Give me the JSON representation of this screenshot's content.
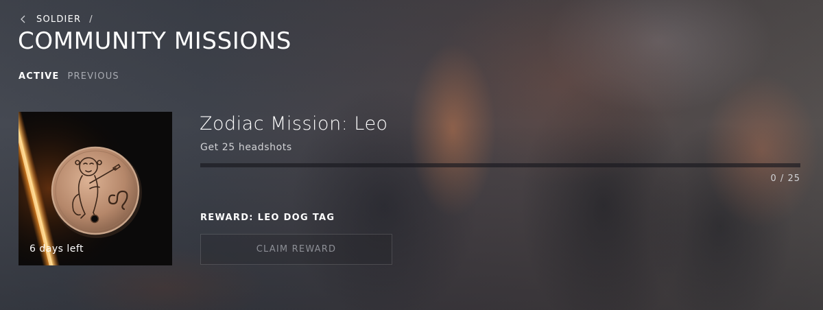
{
  "breadcrumb": {
    "back_icon": "chevron-left-icon",
    "parent": "SOLDIER",
    "separator": "/"
  },
  "page_title": "COMMUNITY MISSIONS",
  "tabs": [
    {
      "label": "ACTIVE",
      "active": true
    },
    {
      "label": "PREVIOUS",
      "active": false
    }
  ],
  "mission": {
    "image": "leo-dog-tag-medallion",
    "time_left": "6 days left",
    "title": "Zodiac Mission: Leo",
    "description": "Get 25 headshots",
    "progress": {
      "current": 0,
      "total": 25,
      "label": "0 / 25"
    },
    "reward_label": "REWARD: LEO DOG TAG",
    "claim_button": {
      "label": "CLAIM REWARD",
      "enabled": false
    }
  },
  "colors": {
    "accent": "#f4a642",
    "text_primary": "#ffffff",
    "text_muted": "#a8abb2",
    "button_text_disabled": "#8d8f96"
  }
}
